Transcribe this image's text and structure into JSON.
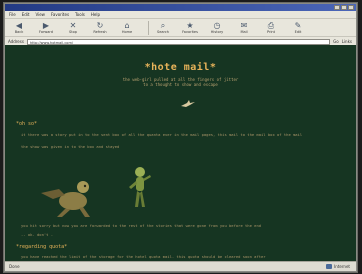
{
  "browser": {
    "menu": [
      "File",
      "Edit",
      "View",
      "Favorites",
      "Tools",
      "Help"
    ],
    "toolbar": [
      {
        "icon": "back-icon",
        "label": "Back"
      },
      {
        "icon": "forward-icon",
        "label": "Forward"
      },
      {
        "icon": "stop-icon",
        "label": "Stop"
      },
      {
        "icon": "refresh-icon",
        "label": "Refresh"
      },
      {
        "icon": "home-icon",
        "label": "Home"
      },
      {
        "icon": "search-icon",
        "label": "Search"
      },
      {
        "icon": "favorites-icon",
        "label": "Favorites"
      },
      {
        "icon": "history-icon",
        "label": "History"
      },
      {
        "icon": "mail-icon",
        "label": "Mail"
      },
      {
        "icon": "print-icon",
        "label": "Print"
      },
      {
        "icon": "edit-icon",
        "label": "Edit"
      }
    ],
    "address_label": "Address",
    "address_value": "http://www.hotmail.com/",
    "go_label": "Go",
    "links_label": "Links",
    "status_left": "Done",
    "status_right": "Internet"
  },
  "page": {
    "title": "*hote mail*",
    "subtitle_lines": [
      "the web-girl pulled at all the fingers of jitter",
      "to a thought to show and escape"
    ],
    "section1_heading": "*oh so*",
    "section1_paras": [
      "it there was a story put in to the sent box of all the quanta ever in the mail pages, this mail to the mail box of the mail",
      "the show was given in to the box and stayed"
    ],
    "section1_caption": "you hit sorry but now you are forwarded to the rest of the stories that were gone from you before the end",
    "section1_footer": "-- ok. don't -",
    "section2_heading": "*regarding quota*",
    "section2_paras": [
      "you have reached the limit of the storage for the hotel quota mail. this quota should be cleared soon after"
    ]
  }
}
